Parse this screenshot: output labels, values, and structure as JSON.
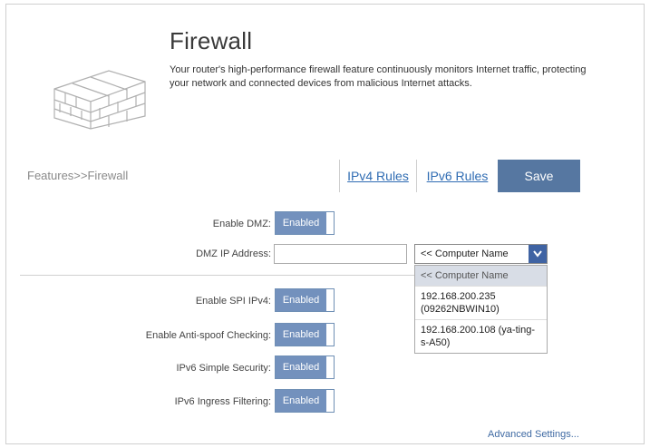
{
  "page": {
    "title": "Firewall",
    "description": "Your router's high-performance firewall feature continuously monitors Internet traffic, protecting your network and connected devices from malicious Internet attacks."
  },
  "breadcrumb": "Features>>Firewall",
  "tabs": {
    "ipv4": "IPv4 Rules",
    "ipv6": "IPv6 Rules"
  },
  "save_label": "Save",
  "fields": {
    "dmz": {
      "label": "Enable DMZ:",
      "state": "Enabled"
    },
    "dmz_ip": {
      "label": "DMZ IP Address:",
      "value": ""
    },
    "computer_select": {
      "selected": "<< Computer Name"
    },
    "spi": {
      "label": "Enable SPI IPv4:",
      "state": "Enabled"
    },
    "antispoof": {
      "label": "Enable Anti-spoof Checking:",
      "state": "Enabled"
    },
    "ipv6_simple": {
      "label": "IPv6 Simple Security:",
      "state": "Enabled"
    },
    "ipv6_ingress": {
      "label": "IPv6 Ingress Filtering:",
      "state": "Enabled"
    }
  },
  "dropdown_options": [
    "<< Computer Name",
    "192.168.200.235 (09262NBWIN10)",
    "192.168.200.108 (ya-ting-s-A50)"
  ],
  "advanced_link": "Advanced Settings...",
  "colors": {
    "accent": "#5677a1",
    "toggle": "#7391bd",
    "link": "#2f6cb3",
    "chevron_bg": "#3f63a3"
  },
  "icons": {
    "hero": "brick-wall-icon",
    "chevron": "chevron-down-icon"
  }
}
